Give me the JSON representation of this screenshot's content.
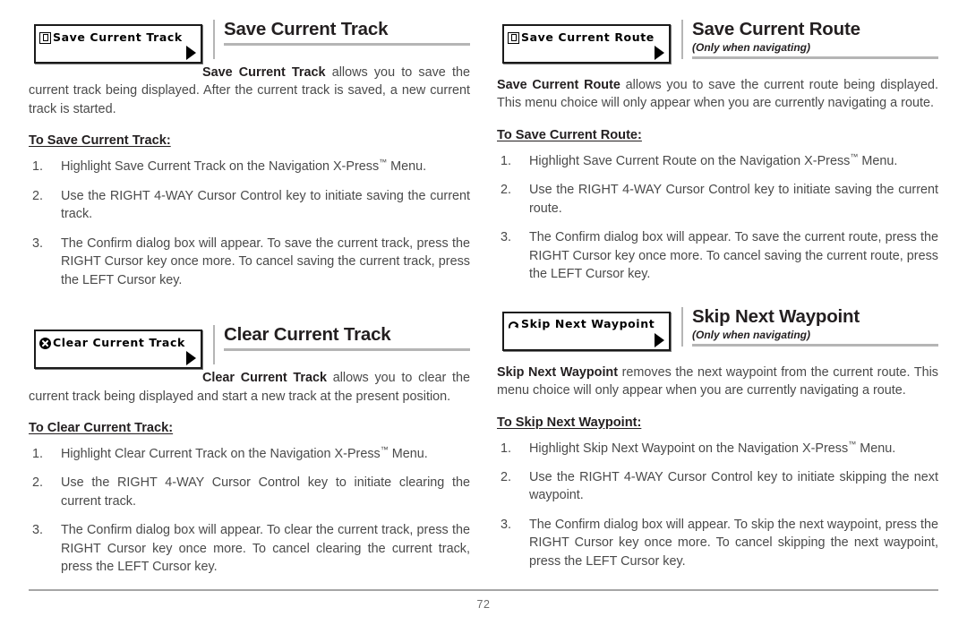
{
  "page": {
    "number": "72"
  },
  "left_column": {
    "sections": [
      {
        "menu": {
          "label": "Save Current Track",
          "icon": "save-box-icon",
          "arrow": "right-arrow-icon"
        },
        "title": "Save Current Track",
        "subtitle": "",
        "body_lead": "Save Current Track",
        "body_rest": " allows you to save the current track being displayed. After the current track is saved, a new current track is started.",
        "subhead": "To Save Current Track:",
        "steps": [
          {
            "num": "1.",
            "text": "Highlight Save Current Track on the Navigation X-Press™ Menu."
          },
          {
            "num": "2.",
            "text": "Use the RIGHT 4-WAY Cursor Control key to initiate saving the current track."
          },
          {
            "num": "3.",
            "text": "The Confirm dialog box will appear. To save the current track, press the RIGHT Cursor key once more. To cancel saving the current track, press the LEFT Cursor key."
          }
        ]
      },
      {
        "menu": {
          "label": "Clear Current Track",
          "icon": "clear-x-icon",
          "arrow": "right-arrow-icon"
        },
        "title": "Clear Current Track",
        "subtitle": "",
        "body_lead": "Clear Current Track",
        "body_rest": " allows you to clear the current track being displayed and start a new track at the present position.",
        "subhead": "To Clear Current Track:",
        "steps": [
          {
            "num": "1.",
            "text": "Highlight Clear Current Track on the Navigation X-Press™ Menu."
          },
          {
            "num": "2.",
            "text": "Use the RIGHT 4-WAY Cursor Control key to initiate clearing the current track."
          },
          {
            "num": "3.",
            "text": "The Confirm dialog box will appear. To clear the current track, press the RIGHT Cursor key once more. To cancel clearing the current track, press the LEFT Cursor key."
          }
        ]
      }
    ]
  },
  "right_column": {
    "sections": [
      {
        "menu": {
          "label": "Save Current Route",
          "icon": "save-box-icon",
          "arrow": "right-arrow-icon"
        },
        "title": "Save Current Route",
        "subtitle": "(Only when navigating)",
        "body_lead": "Save Current Route",
        "body_rest": " allows you to save the current route being displayed. This menu choice will only appear when you are currently navigating a route.",
        "subhead": "To Save Current Route:",
        "steps": [
          {
            "num": "1.",
            "text": "Highlight Save Current Route on the Navigation X-Press™ Menu."
          },
          {
            "num": "2.",
            "text": "Use the RIGHT 4-WAY Cursor Control key to initiate saving the current route."
          },
          {
            "num": "3.",
            "text": "The Confirm dialog box will appear. To save the current route, press the RIGHT Cursor key once more. To cancel saving the current route, press the LEFT Cursor key."
          }
        ]
      },
      {
        "menu": {
          "label": "Skip Next Waypoint",
          "icon": "skip-arrow-icon",
          "arrow": "right-arrow-icon"
        },
        "title": "Skip Next Waypoint",
        "subtitle": "(Only when navigating)",
        "body_lead": "Skip Next Waypoint",
        "body_rest": " removes the next waypoint from the current route. This menu choice will only appear when you are currently navigating a route.",
        "subhead": "To Skip Next Waypoint:",
        "steps": [
          {
            "num": "1.",
            "text": "Highlight Skip Next Waypoint on the Navigation X-Press™ Menu."
          },
          {
            "num": "2.",
            "text": "Use the RIGHT 4-WAY Cursor Control key to initiate skipping the next waypoint."
          },
          {
            "num": "3.",
            "text": "The Confirm dialog box will appear. To skip the next waypoint, press the RIGHT Cursor key once more. To cancel skipping the next waypoint, press the LEFT Cursor key."
          }
        ]
      }
    ]
  },
  "colors": {
    "body_text": "#4a4a4a",
    "heading_text": "#231f20",
    "rule": "#b5b5b5",
    "menu_border": "#1a1a1a"
  }
}
